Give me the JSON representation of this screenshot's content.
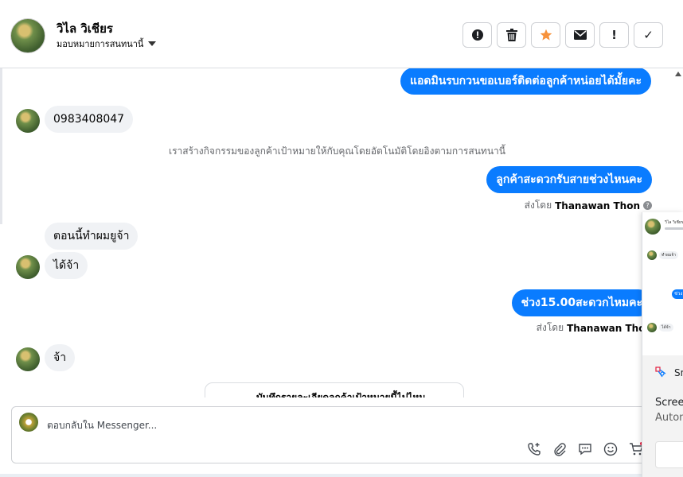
{
  "header": {
    "contact_name": "วิไล วิเชียร",
    "assign_label": "มอบหมายการสนทนานี้",
    "actions": [
      {
        "icon": "alert-circle-icon",
        "glyph": "!"
      },
      {
        "icon": "trash-icon",
        "glyph": ""
      },
      {
        "icon": "star-icon",
        "glyph": ""
      },
      {
        "icon": "envelope-icon",
        "glyph": ""
      },
      {
        "icon": "exclamation-icon",
        "glyph": "!"
      },
      {
        "icon": "check-icon",
        "glyph": "✓"
      }
    ]
  },
  "messages": {
    "out_1": "แอดมินรบกวนขอเบอร์ติดต่อลูกค้าหน่อยได้มั้ยคะ",
    "in_phone": "0983408047",
    "system_note": "เราสร้างกิจกรรมของลูกค้าเป้าหมายให้กับคุณโดยอัตโนมัติโดยอิงตามการสนทนานี้",
    "out_2": "ลูกค้าสะดวกรับสายช่วงไหนคะ",
    "sent_by_prefix": "ส่งโดย",
    "sent_by_name": "Thanawan Thon",
    "in_2": "ตอนนี้ทำผมยูจ้า",
    "in_3": "ได้จ้า",
    "out_3": "ช่วง15.00สะดวกไหมคะ",
    "in_4": "จ้า",
    "card_peek": "บันทึกรายละเอียดลูกค้าเป้าหมายนี้ไปไหม"
  },
  "composer": {
    "placeholder": "ตอบกลับใน Messenger..."
  },
  "overlay": {
    "mini_name": "วิไล วิเชียร",
    "mini_msg_1": "ทำผมจ้า",
    "mini_msg_2": "ช่วง15",
    "mini_msg_3": "ได้จ้า",
    "app_label": "Sni",
    "title": "Screen",
    "subtitle": "Autom"
  },
  "colors": {
    "accent": "#0a7cff",
    "star": "#f7923b"
  }
}
